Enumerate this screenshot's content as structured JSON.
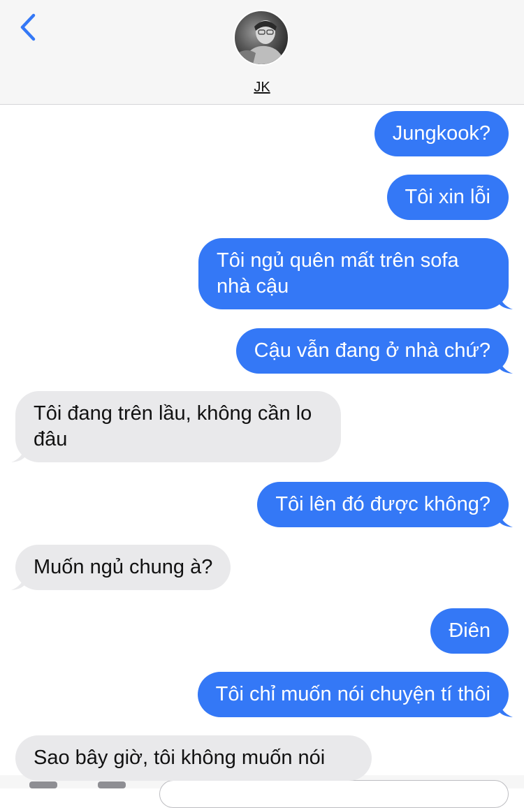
{
  "header": {
    "contact_name": "JK",
    "avatar": "contact-photo",
    "back_icon": "chevron-left-icon"
  },
  "colors": {
    "outgoing": "#3478f6",
    "incoming": "#e9e9eb",
    "accent": "#3478f6"
  },
  "messages": [
    {
      "dir": "out",
      "text": "Jungkook?"
    },
    {
      "dir": "out",
      "text": "Tôi xin lỗi"
    },
    {
      "dir": "out",
      "text": "Tôi ngủ quên mất trên sofa nhà cậu"
    },
    {
      "dir": "out",
      "text": "Cậu vẫn đang ở nhà chứ?"
    },
    {
      "dir": "in",
      "text": "Tôi đang trên lầu, không cần lo đâu"
    },
    {
      "dir": "out",
      "text": "Tôi lên đó được không?"
    },
    {
      "dir": "in",
      "text": "Muốn ngủ chung à?"
    },
    {
      "dir": "out",
      "text": "Điên"
    },
    {
      "dir": "out",
      "text": "Tôi chỉ muốn nói chuyện tí thôi"
    },
    {
      "dir": "in",
      "text": "Sao bây giờ, tôi không muốn nói"
    }
  ]
}
